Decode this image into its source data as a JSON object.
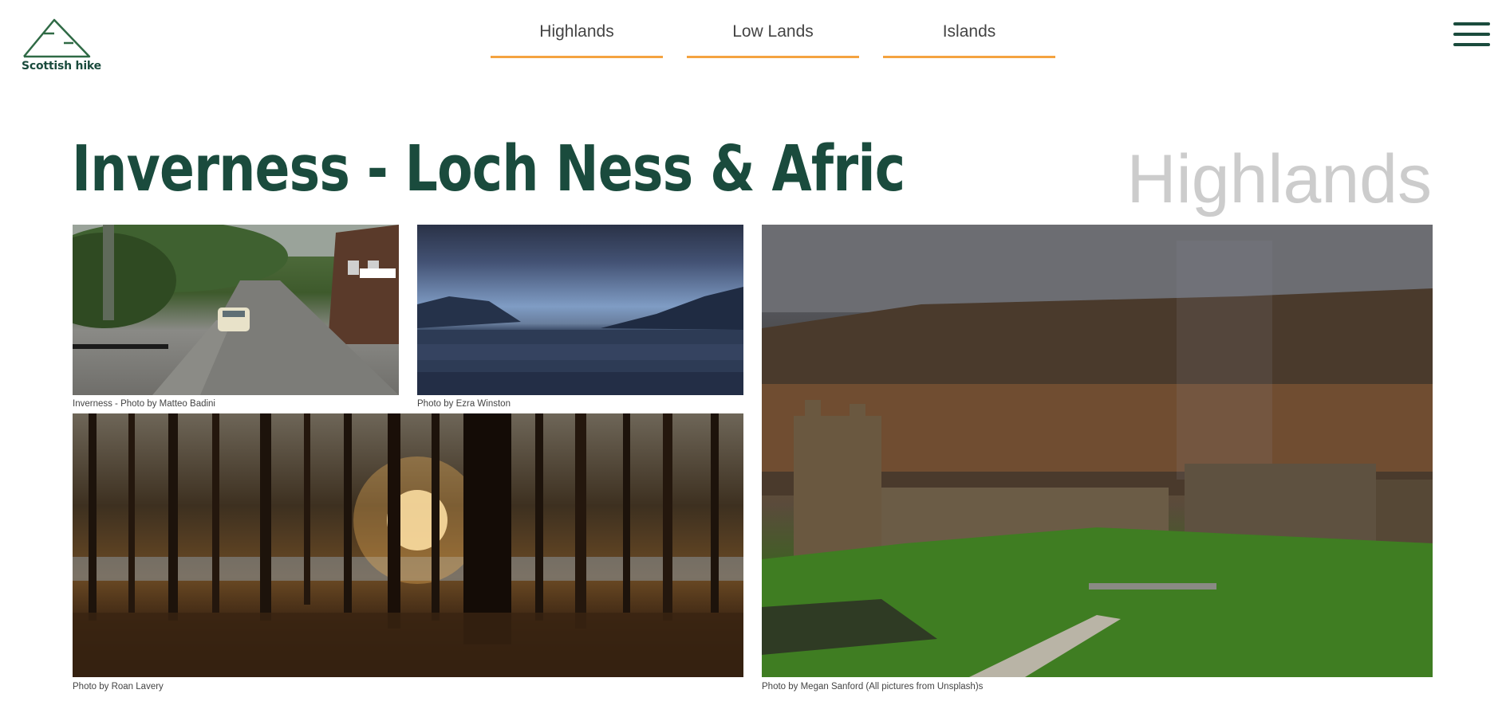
{
  "logo": {
    "text": "Scottish hike",
    "color": "#1a4b3d"
  },
  "nav": {
    "links": [
      "Highlands",
      "Low Lands",
      "Islands"
    ],
    "underline_color": "#f4a340",
    "menu_icon": "hamburger-menu-icon"
  },
  "heading": {
    "title": "Inverness - Loch Ness & Afric",
    "region": "Highlands",
    "title_color": "#1a4b3d",
    "region_color": "#cccccc"
  },
  "photos": [
    {
      "subject": "street-scene",
      "caption": "Inverness - Photo by Matteo Badini"
    },
    {
      "subject": "loch-water",
      "caption": "Photo by Ezra Winston"
    },
    {
      "subject": "forest-sunset",
      "caption": "Photo by Roan Lavery"
    },
    {
      "subject": "castle-ruin",
      "caption": "Photo by Megan Sanford (All pictures from Unsplash)s"
    }
  ]
}
